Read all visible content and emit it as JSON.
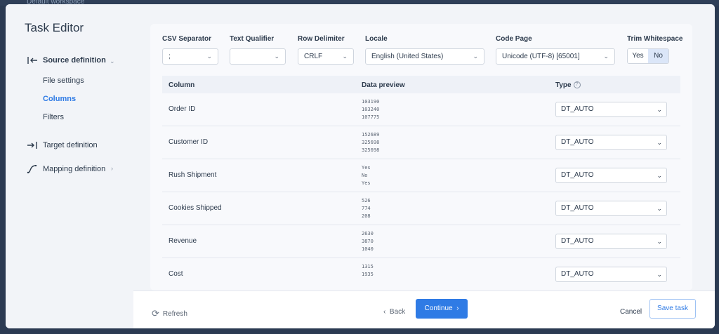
{
  "background": {
    "workspace_label": "Default workspace"
  },
  "sidebar": {
    "title": "Task Editor",
    "items": [
      {
        "label": "Source definition",
        "icon": "source-icon"
      },
      {
        "label": "Target definition",
        "icon": "target-icon"
      },
      {
        "label": "Mapping definition",
        "icon": "mapping-icon"
      }
    ],
    "subitems": [
      {
        "label": "File settings"
      },
      {
        "label": "Columns"
      },
      {
        "label": "Filters"
      }
    ]
  },
  "settings": {
    "csv_separator": {
      "label": "CSV Separator",
      "value": ";"
    },
    "text_qualifier": {
      "label": "Text Qualifier",
      "value": ""
    },
    "row_delimiter": {
      "label": "Row Delimiter",
      "value": "CRLF"
    },
    "locale": {
      "label": "Locale",
      "value": "English (United States)"
    },
    "code_page": {
      "label": "Code Page",
      "value": "Unicode (UTF-8) [65001]"
    },
    "trim_whitespace": {
      "label": "Trim Whitespace",
      "yes": "Yes",
      "no": "No",
      "selected": "No"
    }
  },
  "table": {
    "headers": {
      "column": "Column",
      "preview": "Data preview",
      "type": "Type"
    },
    "rows": [
      {
        "name": "Order ID",
        "preview": [
          "103190",
          "103240",
          "107775"
        ],
        "type": "DT_AUTO"
      },
      {
        "name": "Customer ID",
        "preview": [
          "152689",
          "325698",
          "325698"
        ],
        "type": "DT_AUTO"
      },
      {
        "name": "Rush Shipment",
        "preview": [
          "Yes",
          "No",
          "Yes"
        ],
        "type": "DT_AUTO"
      },
      {
        "name": "Cookies Shipped",
        "preview": [
          "526",
          "774",
          "208"
        ],
        "type": "DT_AUTO"
      },
      {
        "name": "Revenue",
        "preview": [
          "2630",
          "3870",
          "1040"
        ],
        "type": "DT_AUTO"
      },
      {
        "name": "Cost",
        "preview": [
          "1315",
          "1935"
        ],
        "type": "DT_AUTO"
      }
    ]
  },
  "footer": {
    "refresh": "Refresh",
    "back": "Back",
    "continue": "Continue",
    "cancel": "Cancel",
    "save": "Save task"
  },
  "colors": {
    "accent": "#2f7be5",
    "sidebar_bg": "#f2f4f8"
  }
}
